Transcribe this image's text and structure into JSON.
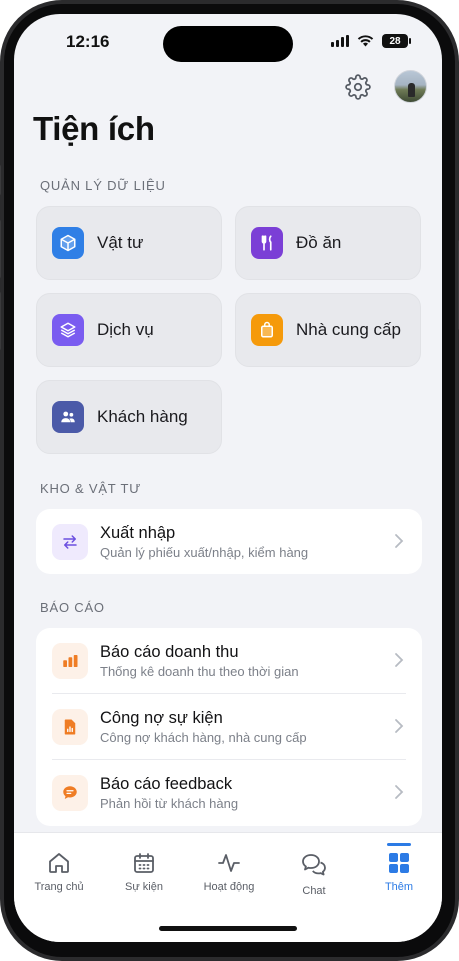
{
  "status": {
    "time": "12:16",
    "battery": "28"
  },
  "header": {
    "title": "Tiện ích",
    "settings_icon": "gear-icon",
    "avatar": "user-avatar"
  },
  "sections": {
    "data_management": "QUẢN LÝ DỮ LIỆU",
    "warehouse": "KHO & VẬT TƯ",
    "reports": "BÁO CÁO"
  },
  "tiles": [
    {
      "label": "Vật tư",
      "icon": "box-icon",
      "color": "#2f7fe6"
    },
    {
      "label": "Đồ ăn",
      "icon": "fork-knife-icon",
      "color": "#7b3fd6"
    },
    {
      "label": "Dịch vụ",
      "icon": "layers-icon",
      "color": "#7a5cf0"
    },
    {
      "label": "Nhà cung cấp",
      "icon": "bag-icon",
      "color": "#f59a0b"
    },
    {
      "label": "Khách hàng",
      "icon": "users-icon",
      "color": "#4b5aa8"
    }
  ],
  "warehouse_rows": [
    {
      "title": "Xuất nhập",
      "subtitle": "Quản lý phiếu xuất/nhập, kiểm hàng",
      "icon": "swap-arrows-icon",
      "color": "#6b4fe0"
    }
  ],
  "report_rows": [
    {
      "title": "Báo cáo doanh thu",
      "subtitle": "Thống kê doanh thu theo thời gian",
      "icon": "bar-chart-icon",
      "color": "#ef7d25"
    },
    {
      "title": "Công nợ sự kiện",
      "subtitle": "Công nợ khách hàng, nhà cung cấp",
      "icon": "document-chart-icon",
      "color": "#ef7d25"
    },
    {
      "title": "Báo cáo feedback",
      "subtitle": "Phản hồi từ khách hàng",
      "icon": "chat-bubble-icon",
      "color": "#ef7d25"
    }
  ],
  "tabs": [
    {
      "label": "Trang chủ",
      "icon": "home-icon"
    },
    {
      "label": "Sự kiện",
      "icon": "calendar-icon"
    },
    {
      "label": "Hoạt động",
      "icon": "activity-icon"
    },
    {
      "label": "Chat",
      "icon": "chat-icon"
    },
    {
      "label": "Thêm",
      "icon": "grid-icon",
      "active": true
    }
  ],
  "colors": {
    "accent": "#2c7be5",
    "background": "#f2f3f7"
  }
}
